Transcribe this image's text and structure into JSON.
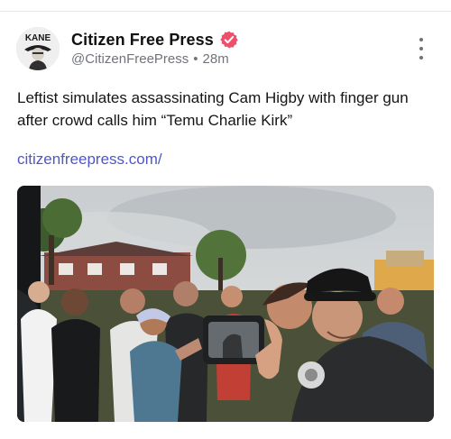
{
  "account": {
    "name": "Citizen Free Press",
    "handle": "@CitizenFreePress",
    "separator": "•",
    "time": "28m",
    "avatar_text": "KANE"
  },
  "post": {
    "text": "Leftist simulates assassinating Cam Higby with finger gun after crowd calls him “Temu Charlie Kirk”",
    "link": "citizenfreepress.com/"
  },
  "icons": {
    "verified": "verified-badge-icon",
    "more": "more-vertical-icon"
  },
  "colors": {
    "verified_bg": "#ee4f6a",
    "link": "#4f56c9",
    "muted_text": "#70747a"
  }
}
